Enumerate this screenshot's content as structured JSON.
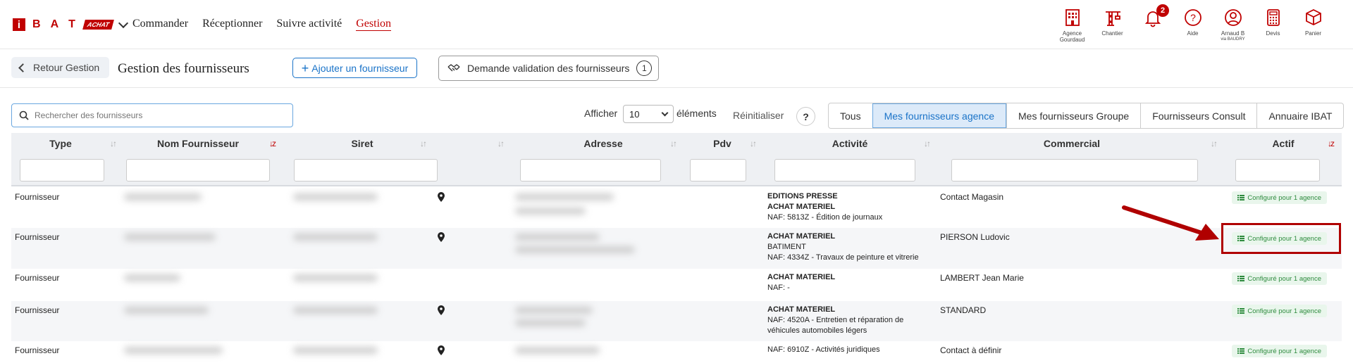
{
  "logo": {
    "i": "i",
    "letters": [
      "B",
      "A",
      "T"
    ],
    "badge": "ACHAT"
  },
  "nav": {
    "commander": "Commander",
    "receptionner": "Réceptionner",
    "suivre": "Suivre activité",
    "gestion": "Gestion"
  },
  "topright": {
    "agence": [
      "Agence",
      "Gourdaud"
    ],
    "chantier": "Chantier",
    "notifications_count": "2",
    "aide": "Aide",
    "user": [
      "Arnaud B",
      "via BAUDRY"
    ],
    "devis": "Devis",
    "panier": "Panier"
  },
  "subheader": {
    "back": "Retour Gestion",
    "title": "Gestion des fournisseurs",
    "add": "Ajouter un fournisseur",
    "validation": "Demande validation des fournisseurs",
    "validation_count": "1"
  },
  "toolbar": {
    "search_placeholder": "Rechercher des fournisseurs",
    "afficher": "Afficher",
    "page_size": "10",
    "elements": "éléments",
    "reinit": "Réinitialiser",
    "help": "?",
    "tabs": [
      "Tous",
      "Mes fournisseurs agence",
      "Mes fournisseurs Groupe",
      "Fournisseurs Consult",
      "Annuaire IBAT"
    ]
  },
  "columns": [
    "Type",
    "Nom Fournisseur",
    "Siret",
    "",
    "Adresse",
    "Pdv",
    "Activité",
    "Commercial",
    "Actif"
  ],
  "rows": [
    {
      "type": "Fournisseur",
      "activity": [
        "EDITIONS PRESSE",
        "ACHAT MATERIEL"
      ],
      "naf": "NAF: 5813Z - Édition de journaux",
      "commercial": "Contact Magasin",
      "actif": "Configuré pour 1 agence"
    },
    {
      "type": "Fournisseur",
      "activity": [
        "ACHAT MATERIEL"
      ],
      "activity_plain": "BATIMENT",
      "naf": "NAF: 4334Z - Travaux de peinture et vitrerie",
      "commercial": "PIERSON Ludovic",
      "actif": "Configuré pour 1 agence"
    },
    {
      "type": "Fournisseur",
      "activity": [
        "ACHAT MATERIEL"
      ],
      "naf": "NAF: -",
      "commercial": "LAMBERT Jean Marie",
      "actif": "Configuré pour 1 agence"
    },
    {
      "type": "Fournisseur",
      "activity": [
        "ACHAT MATERIEL"
      ],
      "naf": "NAF: 4520A - Entretien et réparation de",
      "naf2": "véhicules automobiles légers",
      "commercial": "STANDARD",
      "actif": "Configuré pour 1 agence"
    },
    {
      "type": "Fournisseur",
      "activity": [],
      "naf": "NAF: 6910Z - Activités juridiques",
      "commercial": "Contact à définir",
      "actif": "Configuré pour 1 agence"
    }
  ],
  "colors": {
    "brand": "#c00000",
    "primary": "#1a73c8",
    "success": "#2e8b3e"
  }
}
